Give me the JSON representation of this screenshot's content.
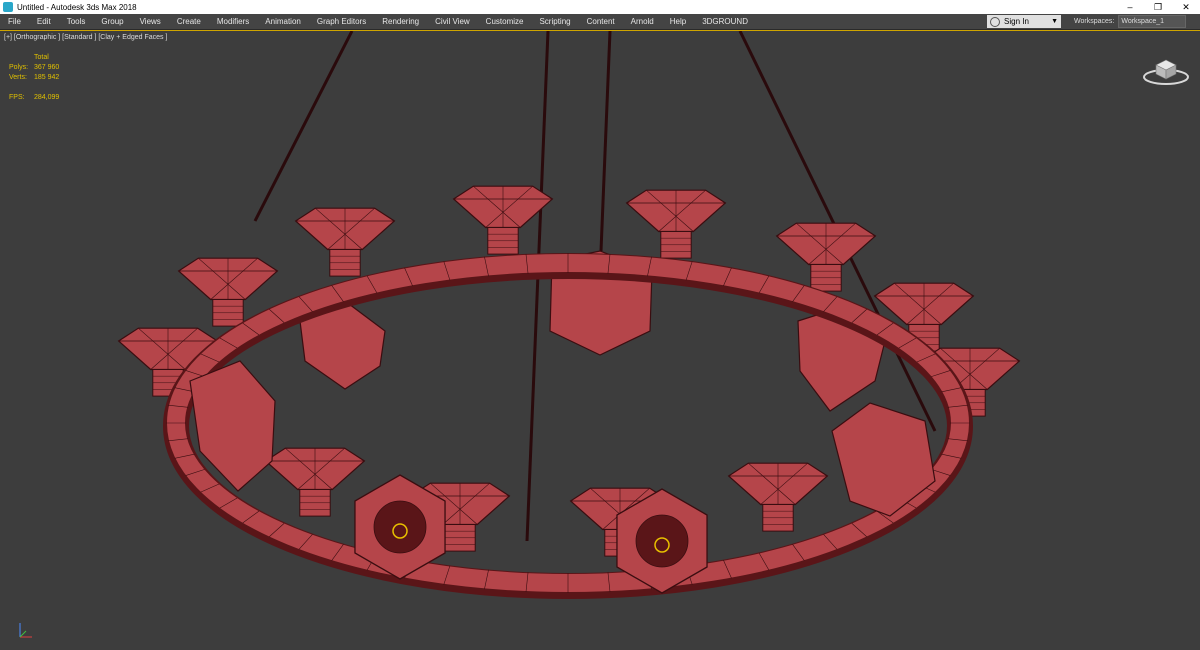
{
  "window": {
    "title": "Untitled - Autodesk 3ds Max 2018",
    "controls": [
      "–",
      "❐",
      "✕"
    ]
  },
  "menu": {
    "items": [
      "File",
      "Edit",
      "Tools",
      "Group",
      "Views",
      "Create",
      "Modifiers",
      "Animation",
      "Graph Editors",
      "Rendering",
      "Civil View",
      "Customize",
      "Scripting",
      "Content",
      "Arnold",
      "Help",
      "3DGROUND"
    ],
    "sign_in": "Sign In",
    "workspaces_label": "Workspaces:",
    "workspace_value": "Workspace_1"
  },
  "viewport": {
    "label": "[+] [Orthographic ] [Standard ] [Clay + Edged Faces ]",
    "stats": {
      "total_label": "Total",
      "polys_label": "Polys:",
      "polys_value": "367 960",
      "verts_label": "Verts:",
      "verts_value": "185 942",
      "fps_label": "FPS:",
      "fps_value": "284,099"
    }
  },
  "colors": {
    "viewport_bg": "#3d3d3d",
    "model_fill": "#b5454a",
    "wire": "#3a0d10",
    "stats_text": "#e0c000",
    "active_border": "#cfa500"
  }
}
